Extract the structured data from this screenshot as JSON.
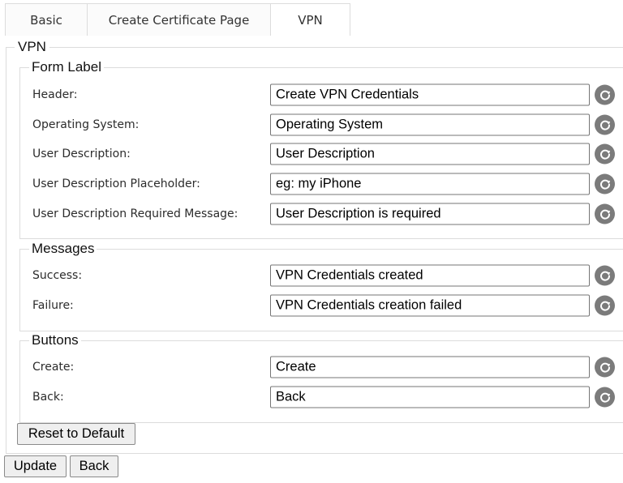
{
  "tabs": [
    {
      "label": "Basic"
    },
    {
      "label": "Create Certificate Page"
    },
    {
      "label": "VPN"
    }
  ],
  "vpn": {
    "legend": "VPN",
    "form_label": {
      "legend": "Form Label",
      "fields": [
        {
          "label": "Header:",
          "value": "Create VPN Credentials"
        },
        {
          "label": "Operating System:",
          "value": "Operating System"
        },
        {
          "label": "User Description:",
          "value": "User Description"
        },
        {
          "label": "User Description Placeholder:",
          "value": "eg: my iPhone"
        },
        {
          "label": "User Description Required Message:",
          "value": "User Description is required"
        }
      ]
    },
    "messages": {
      "legend": "Messages",
      "fields": [
        {
          "label": "Success:",
          "value": "VPN Credentials created"
        },
        {
          "label": "Failure:",
          "value": "VPN Credentials creation failed"
        }
      ]
    },
    "buttons": {
      "legend": "Buttons",
      "fields": [
        {
          "label": "Create:",
          "value": "Create"
        },
        {
          "label": "Back:",
          "value": "Back"
        }
      ]
    },
    "reset_default_label": "Reset to Default"
  },
  "actions": {
    "update_label": "Update",
    "back_label": "Back"
  },
  "icons": {
    "field_reset": "reset-icon"
  },
  "colors": {
    "border": "#dcdcdc",
    "icon_bg": "#7b7b7b"
  }
}
